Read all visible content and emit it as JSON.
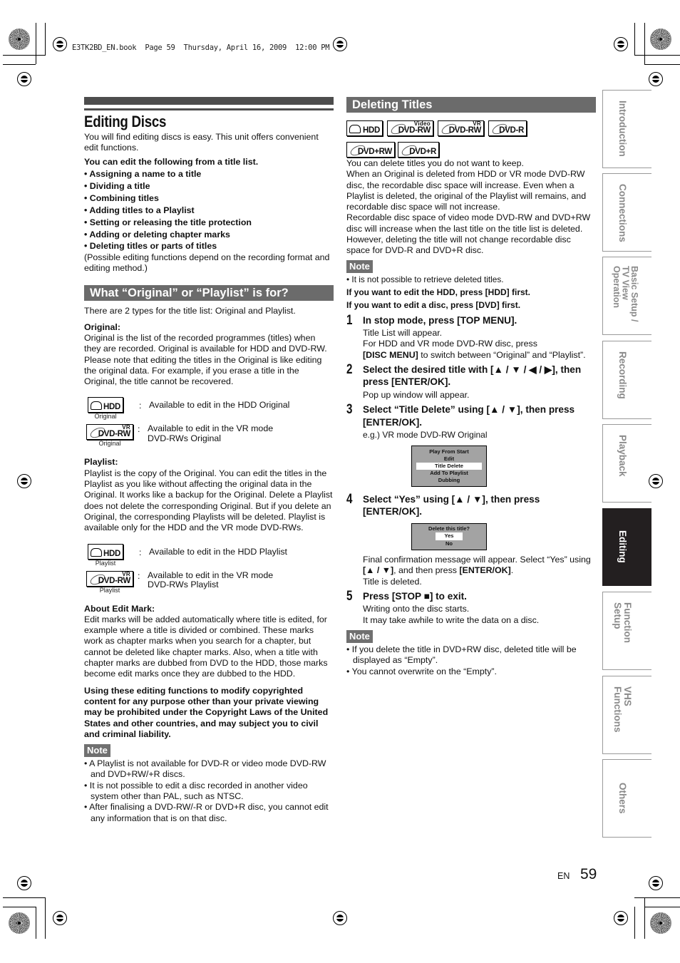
{
  "print_header": "E3TK2BD_EN.book  Page 59  Thursday, April 16, 2009  12:00 PM",
  "left": {
    "title": "Editing Discs",
    "intro": "You will find editing discs is easy. This unit offers convenient edit functions.",
    "list_heading": "You can edit the following from a title list.",
    "functions": [
      "Assigning a name to a title",
      "Dividing a title",
      "Combining titles",
      "Adding titles to a Playlist",
      "Setting or releasing the title protection",
      "Adding or deleting chapter marks",
      "Deleting titles or parts of titles"
    ],
    "functions_note": "(Possible editing functions depend on the recording format and editing method.)",
    "section_title": "What “Original” or “Playlist” is for?",
    "types_text": "There are 2 types for the title list: Original and Playlist.",
    "original_heading": "Original:",
    "original_text": "Original is the list of the recorded programmes (titles) when they are recorded. Original is available for HDD and DVD-RW. Please note that editing the titles in the Original is like editing the original data. For example, if you erase a title in the Original, the title cannot be recovered.",
    "original_icons": [
      {
        "badge": "HDD",
        "sup": "",
        "caption": "Original",
        "desc": "Available to edit in the HDD Original"
      },
      {
        "badge": "DVD-RW",
        "sup": "VR",
        "caption": "Original",
        "desc": "Available to edit in the VR mode DVD-RWs Original"
      }
    ],
    "playlist_heading": "Playlist:",
    "playlist_text": "Playlist is the copy of the Original. You can edit the titles in the Playlist as you like without affecting the original data in the Original. It works like a backup for the Original. Delete a Playlist does not delete the corresponding Original. But if you delete an Original, the corresponding Playlists will be deleted. Playlist is available only for the HDD and the VR mode DVD-RWs.",
    "playlist_icons": [
      {
        "badge": "HDD",
        "sup": "",
        "caption": "Playlist",
        "desc": "Available to edit in the HDD Playlist"
      },
      {
        "badge": "DVD-RW",
        "sup": "VR",
        "caption": "Playlist",
        "desc": "Available to edit in the VR mode DVD-RWs Playlist"
      }
    ],
    "colon": ":",
    "editmark_heading": "About Edit Mark:",
    "editmark_text": "Edit marks will be added automatically where title is edited, for example where a title is divided or combined. These marks work as chapter marks when you search for a chapter, but cannot be deleted like chapter marks. Also, when a title with chapter marks are dubbed from DVD to the HDD, those marks become edit marks once they are dubbed to the HDD.",
    "copyright_warning": "Using these editing functions to modify copyrighted content for any purpose other than your private viewing may be prohibited under the Copyright Laws of the United States and other countries, and may subject you to civil and criminal liability.",
    "note_label": "Note",
    "notes": [
      "A Playlist is not available for DVD-R or video mode DVD-RW and DVD+RW/+R discs.",
      "It is not possible to edit a disc recorded in another video system other than PAL, such as NTSC.",
      "After finalising a DVD-RW/-R or DVD+R disc, you cannot edit any information that is on that disc."
    ]
  },
  "right": {
    "section_title": "Deleting Titles",
    "disc_badges": [
      {
        "label": "HDD",
        "sup": ""
      },
      {
        "label": "DVD-RW",
        "sup": "Video"
      },
      {
        "label": "DVD-RW",
        "sup": "VR"
      },
      {
        "label": "DVD-R",
        "sup": ""
      },
      {
        "label": "DVD+RW",
        "sup": ""
      },
      {
        "label": "DVD+R",
        "sup": ""
      }
    ],
    "intro": [
      "You can delete titles you do not want to keep.",
      "When an Original is deleted from HDD or VR mode DVD-RW disc, the recordable disc space will increase. Even when a Playlist is deleted, the original of the Playlist will remains, and recordable disc space will not increase.",
      "Recordable disc space of video mode DVD-RW and DVD+RW disc will increase when the last title on the title list is deleted. However, deleting the title will not change recordable disc space for DVD-R and DVD+R disc."
    ],
    "note_label": "Note",
    "note1": "It is not possible to retrieve deleted titles.",
    "pre_hdd": "If you want to edit the HDD, press [HDD] first.",
    "pre_dvd": "If you want to edit a disc, press [DVD] first.",
    "steps": [
      {
        "num": "1",
        "title": "In stop mode, press [TOP MENU].",
        "lines": [
          "Title List will appear.",
          "For HDD and VR mode DVD-RW disc, press"
        ],
        "bold_key": "[DISC MENU]",
        "tail": " to switch between “Original” and “Playlist”."
      },
      {
        "num": "2",
        "title": "Select the desired title with [▲ / ▼ / ◀ / ▶], then press [ENTER/OK].",
        "lines": [
          "Pop up window will appear."
        ]
      },
      {
        "num": "3",
        "title": "Select “Title Delete” using [▲ / ▼], then press [ENTER/OK].",
        "lines": [
          "e.g.) VR mode DVD-RW Original"
        ]
      },
      {
        "num": "4",
        "title": "Select “Yes” using [▲ / ▼], then press [ENTER/OK].",
        "lines": [
          "Final confirmation message will appear. Select “Yes” using "
        ],
        "bold_key": "[▲ / ▼]",
        "mid": ", and then press ",
        "bold_key2": "[ENTER/OK]",
        "tail": ".",
        "line_after": "Title is deleted."
      },
      {
        "num": "5",
        "title": "Press [STOP ■] to exit.",
        "lines": [
          "Writing onto the disc starts.",
          "It may take awhile to write the data on a disc."
        ]
      }
    ],
    "popup_menu": {
      "items": [
        "Play From Start",
        "Edit",
        "Title Delete",
        "Add To Playlist",
        "Dubbing"
      ],
      "selected": "Title Delete"
    },
    "confirm_dialog": {
      "question": "Delete this title?",
      "options": [
        "Yes",
        "No"
      ],
      "selected": "Yes"
    },
    "notes2": [
      "If you delete the title in DVD+RW disc, deleted title will be displayed as “Empty”.",
      "You cannot overwrite on the “Empty”."
    ]
  },
  "side_tabs": [
    {
      "label": "Introduction",
      "active": false
    },
    {
      "label": "Connections",
      "active": false
    },
    {
      "label": "Basic Setup / TV View Operation",
      "line1": "Basic Setup /",
      "line2": "TV View Operation",
      "active": false
    },
    {
      "label": "Recording",
      "active": false
    },
    {
      "label": "Playback",
      "active": false
    },
    {
      "label": "Editing",
      "active": true
    },
    {
      "label": "Function Setup",
      "active": false
    },
    {
      "label": "VHS Functions",
      "active": false
    },
    {
      "label": "Others",
      "active": false
    }
  ],
  "footer": {
    "lang": "EN",
    "page": "59"
  }
}
